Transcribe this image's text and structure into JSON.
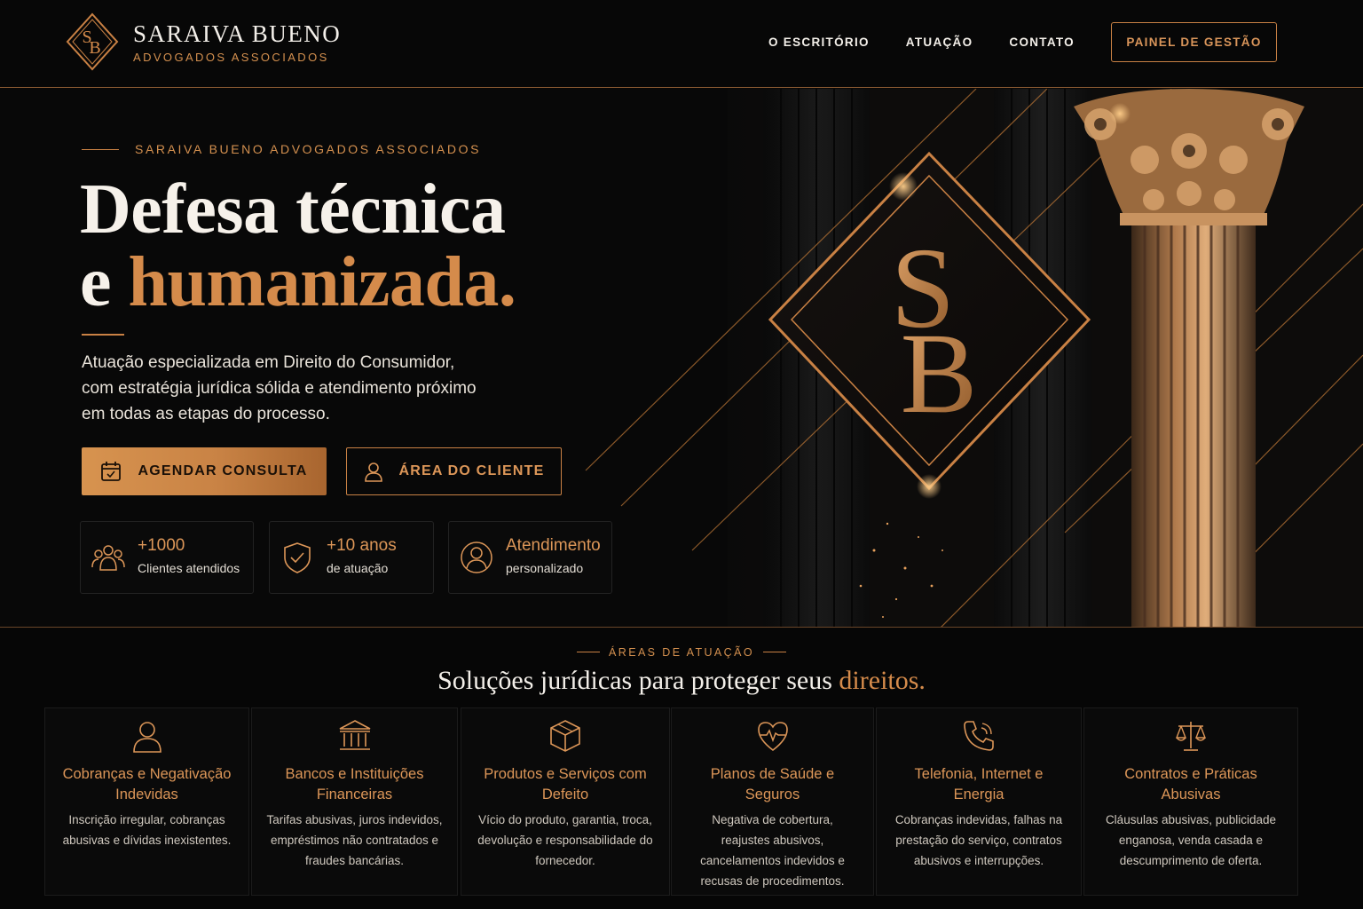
{
  "header": {
    "logo_name": "SARAIVA BUENO",
    "logo_sub": "ADVOGADOS ASSOCIADOS",
    "nav": [
      "O ESCRITÓRIO",
      "ATUAÇÃO",
      "CONTATO"
    ],
    "cta": "PAINEL DE GESTÃO"
  },
  "hero": {
    "eyebrow": "SARAIVA BUENO ADVOGADOS ASSOCIADOS",
    "title_line1": "Defesa técnica",
    "title_line2_prefix": "e ",
    "title_line2_accent": "humanizada.",
    "lead": "Atuação especializada em Direito do Consumidor, com estratégia jurídica sólida e atendimento próximo em todas as etapas do processo.",
    "primary_button": "AGENDAR CONSULTA",
    "secondary_button": "ÁREA DO CLIENTE",
    "stats": [
      {
        "value": "+1000",
        "label": "Clientes atendidos",
        "icon": "users-icon"
      },
      {
        "value": "+10 anos",
        "label": "de atuação",
        "icon": "shield-check-icon"
      },
      {
        "value": "Atendimento",
        "label": "personalizado",
        "icon": "person-icon"
      }
    ],
    "monogram": "SB"
  },
  "areas": {
    "eyebrow": "ÁREAS DE ATUAÇÃO",
    "title_prefix": "Soluções jurídicas para proteger seus ",
    "title_accent": "direitos.",
    "cards": [
      {
        "title": "Cobranças e Negativação Indevidas",
        "desc": "Inscrição irregular, cobranças abusivas e dívidas inexistentes.",
        "icon": "person-icon"
      },
      {
        "title": "Bancos e Instituições Financeiras",
        "desc": "Tarifas abusivas, juros indevidos, empréstimos não contratados e fraudes bancárias.",
        "icon": "bank-icon"
      },
      {
        "title": "Produtos e Serviços com Defeito",
        "desc": "Vício do produto, garantia, troca, devolução e responsabilidade do fornecedor.",
        "icon": "box-icon"
      },
      {
        "title": "Planos de Saúde e Seguros",
        "desc": "Negativa de cobertura, reajustes abusivos, cancelamentos indevidos e recusas de procedimentos.",
        "icon": "heart-pulse-icon"
      },
      {
        "title": "Telefonia, Internet e Energia",
        "desc": "Cobranças indevidas, falhas na prestação do serviço, contratos abusivos e interrupções.",
        "icon": "phone-icon"
      },
      {
        "title": "Contratos e Práticas Abusivas",
        "desc": "Cláusulas abusivas, publicidade enganosa, venda casada e descumprimento de oferta.",
        "icon": "scales-icon"
      }
    ]
  },
  "colors": {
    "accent": "#d58b4b",
    "background": "#060606",
    "text": "#f3efe9"
  }
}
